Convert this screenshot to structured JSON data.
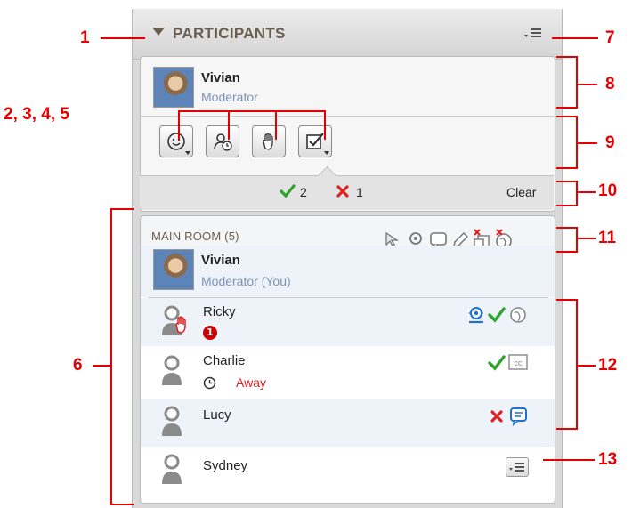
{
  "panel": {
    "title": "PARTICIPANTS",
    "menu_icon": "list-menu-icon",
    "collapse_icon": "triangle-down-icon"
  },
  "moderator": {
    "name": "Vivian",
    "role": "Moderator"
  },
  "status_buttons": [
    "smiley-icon",
    "clock-person-icon",
    "raise-hand-icon",
    "checkbox-icon"
  ],
  "answers": {
    "yes_count": "2",
    "no_count": "1",
    "clear_label": "Clear"
  },
  "room": {
    "title": "MAIN ROOM",
    "count": "(5)",
    "toolbar_icons": [
      "pointer-icon",
      "webcam-icon",
      "chat-icon",
      "pencil-icon",
      "copy-disabled-icon",
      "globe-disabled-icon"
    ],
    "self": {
      "name": "Vivian",
      "role": "Moderator (You)"
    },
    "participants": [
      {
        "name": "Ricky",
        "badge": "1",
        "icons": [
          "webcam-icon",
          "check-icon",
          "globe-icon"
        ]
      },
      {
        "name": "Charlie",
        "status": "Away",
        "icons": [
          "check-icon",
          "cc-icon"
        ]
      },
      {
        "name": "Lucy",
        "icons": [
          "x-icon",
          "chat-icon"
        ]
      },
      {
        "name": "Sydney",
        "icons": [
          "menu-button-icon"
        ]
      }
    ]
  },
  "callouts": [
    "1",
    "2, 3, 4, 5",
    "6",
    "7",
    "8",
    "9",
    "10",
    "11",
    "12",
    "13"
  ],
  "colors": {
    "callout": "#e60000",
    "header_text": "#6b5d4f",
    "role_text": "#7a93b8",
    "check": "#2ea12e",
    "cross": "#e02020",
    "away": "#e02020"
  }
}
